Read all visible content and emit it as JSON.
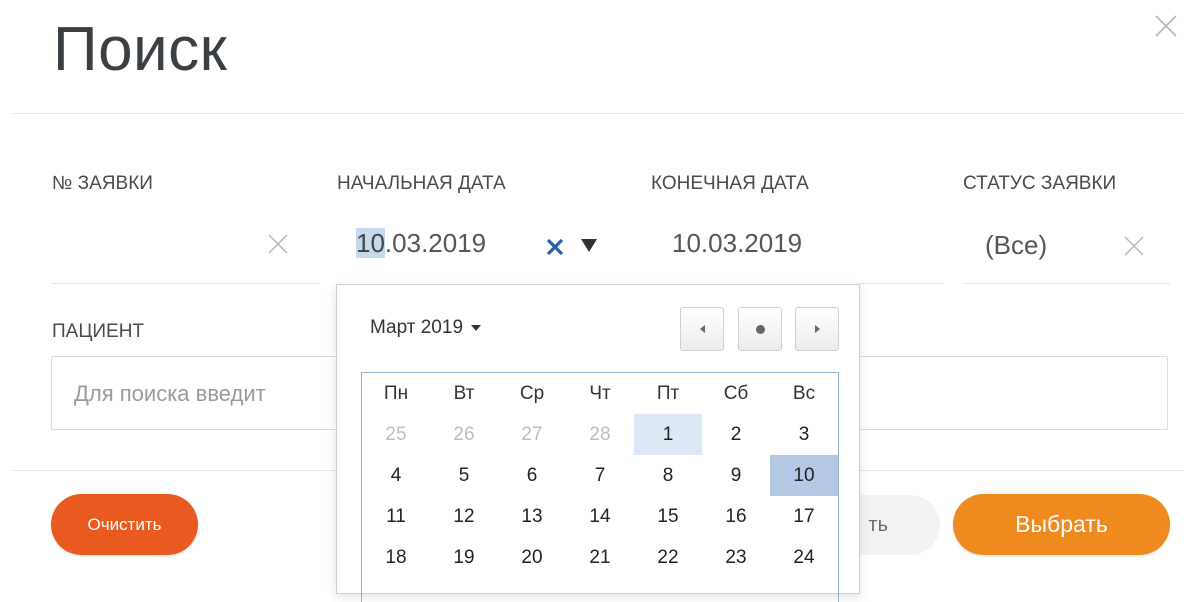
{
  "dialog": {
    "title": "Поиск"
  },
  "fields": {
    "order_no": {
      "label": "№ ЗАЯВКИ",
      "value": ""
    },
    "start_date": {
      "label": "НАЧАЛЬНАЯ ДАТА",
      "value_selected": "10",
      "value_rest": ".03.2019"
    },
    "end_date": {
      "label": "КОНЕЧНАЯ ДАТА",
      "value": "10.03.2019"
    },
    "status": {
      "label": "СТАТУС ЗАЯВКИ",
      "value": "(Все)"
    },
    "patient": {
      "label": "ПАЦИЕНТ",
      "placeholder": "Для поиска введит"
    }
  },
  "buttons": {
    "clear": "Очистить",
    "ghost_partial": "ть",
    "select": "Выбрать"
  },
  "calendar": {
    "month_label": "Март 2019",
    "weekdays": [
      "Пн",
      "Вт",
      "Ср",
      "Чт",
      "Пт",
      "Сб",
      "Вс"
    ],
    "rows": [
      [
        {
          "d": "25",
          "o": true
        },
        {
          "d": "26",
          "o": true
        },
        {
          "d": "27",
          "o": true
        },
        {
          "d": "28",
          "o": true
        },
        {
          "d": "1",
          "t": true
        },
        {
          "d": "2"
        },
        {
          "d": "3"
        }
      ],
      [
        {
          "d": "4"
        },
        {
          "d": "5"
        },
        {
          "d": "6"
        },
        {
          "d": "7"
        },
        {
          "d": "8"
        },
        {
          "d": "9"
        },
        {
          "d": "10",
          "s": true
        }
      ],
      [
        {
          "d": "11"
        },
        {
          "d": "12"
        },
        {
          "d": "13"
        },
        {
          "d": "14"
        },
        {
          "d": "15"
        },
        {
          "d": "16"
        },
        {
          "d": "17"
        }
      ],
      [
        {
          "d": "18"
        },
        {
          "d": "19"
        },
        {
          "d": "20"
        },
        {
          "d": "21"
        },
        {
          "d": "22"
        },
        {
          "d": "23"
        },
        {
          "d": "24"
        }
      ]
    ]
  },
  "colors": {
    "clear_button": "#e85a1f",
    "select_button": "#ef8a1f",
    "selected_day": "#b3c8e3",
    "highlighted_day": "#dce8f6",
    "clear_x_icon": "#2a5ea8"
  }
}
